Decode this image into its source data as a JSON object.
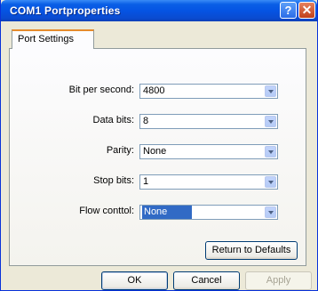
{
  "window": {
    "title": "COM1 Portproperties"
  },
  "tabs": [
    {
      "label": "Port Settings"
    }
  ],
  "fields": {
    "bits_per_second": {
      "label": "Bit per second:",
      "value": "4800"
    },
    "data_bits": {
      "label": "Data bits:",
      "value": "8"
    },
    "parity": {
      "label": "Parity:",
      "value": "None"
    },
    "stop_bits": {
      "label": "Stop bits:",
      "value": "1"
    },
    "flow_control": {
      "label": "Flow conttol:",
      "value": "None"
    }
  },
  "buttons": {
    "return_defaults": "Return to Defaults",
    "ok": "OK",
    "cancel": "Cancel",
    "apply": "Apply"
  },
  "titlebar_buttons": {
    "help": "?",
    "close": "✕"
  },
  "icons": [
    "help-icon",
    "close-icon",
    "chevron-down-icon"
  ],
  "colors": {
    "titlebar": "#0554e3",
    "selection": "#316ac5",
    "tab_accent": "#e68b2c"
  }
}
